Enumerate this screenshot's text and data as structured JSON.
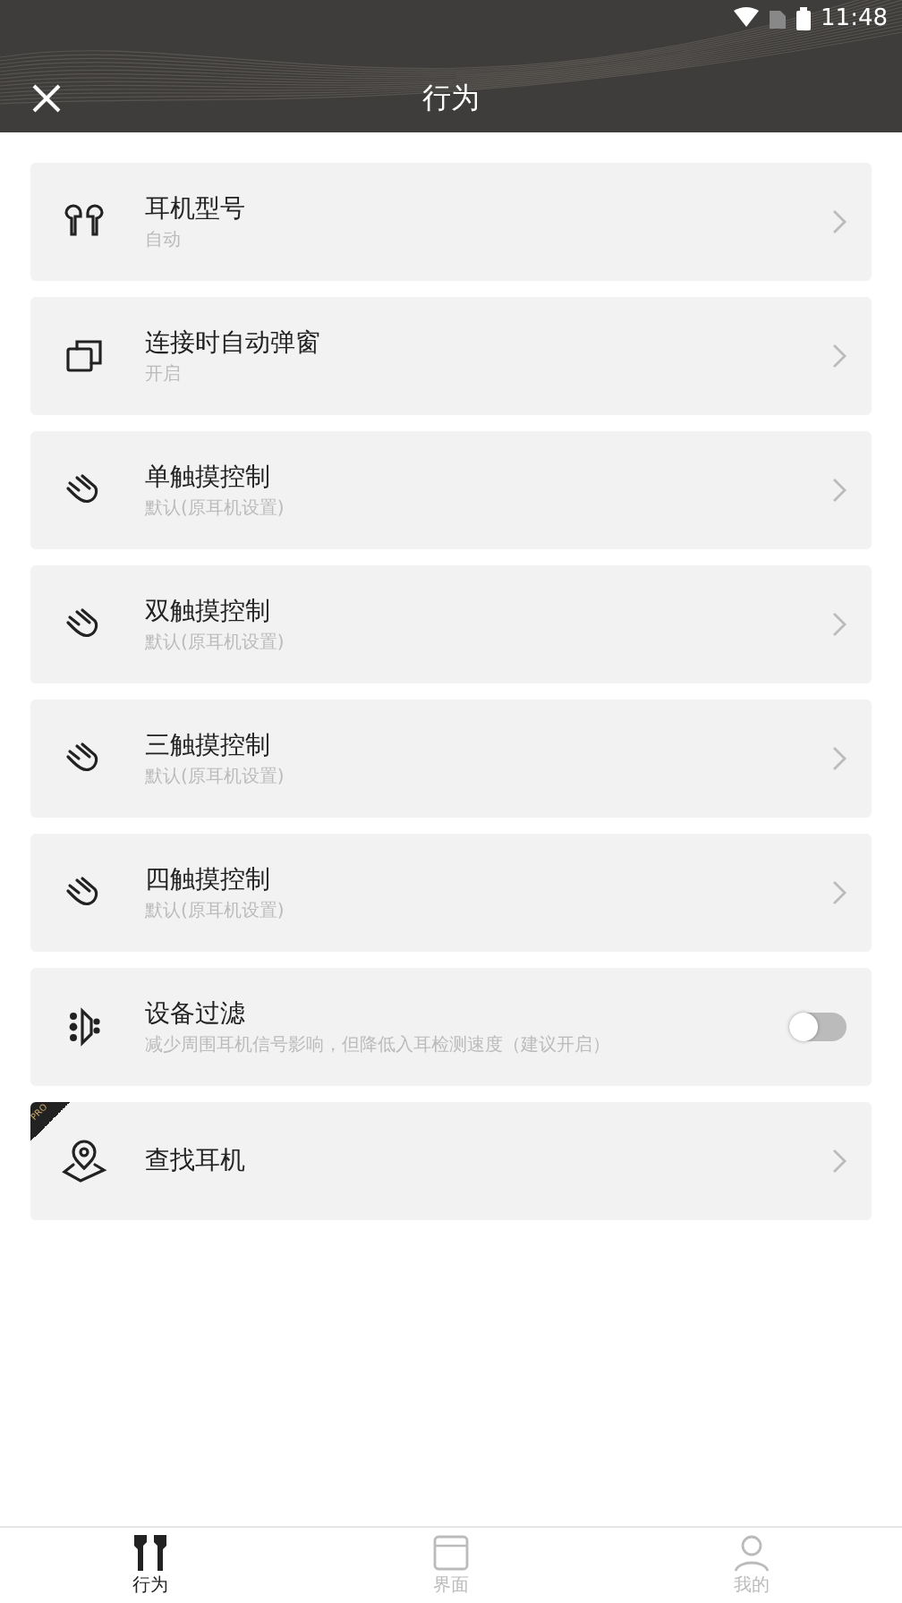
{
  "status_bar": {
    "time": "11:48"
  },
  "header": {
    "title": "行为"
  },
  "items": [
    {
      "kind": "nav",
      "title": "耳机型号",
      "subtitle": "自动"
    },
    {
      "kind": "nav",
      "title": "连接时自动弹窗",
      "subtitle": "开启"
    },
    {
      "kind": "nav",
      "title": "单触摸控制",
      "subtitle": "默认(原耳机设置)"
    },
    {
      "kind": "nav",
      "title": "双触摸控制",
      "subtitle": "默认(原耳机设置)"
    },
    {
      "kind": "nav",
      "title": "三触摸控制",
      "subtitle": "默认(原耳机设置)"
    },
    {
      "kind": "nav",
      "title": "四触摸控制",
      "subtitle": "默认(原耳机设置)"
    },
    {
      "kind": "toggle",
      "title": "设备过滤",
      "subtitle": "减少周围耳机信号影响，但降低入耳检测速度（建议开启）",
      "on": false
    },
    {
      "kind": "nav",
      "title": "查找耳机",
      "badge": "PRO"
    }
  ],
  "tabs": [
    {
      "label": "行为",
      "selected": true
    },
    {
      "label": "界面",
      "selected": false
    },
    {
      "label": "我的",
      "selected": false
    }
  ]
}
